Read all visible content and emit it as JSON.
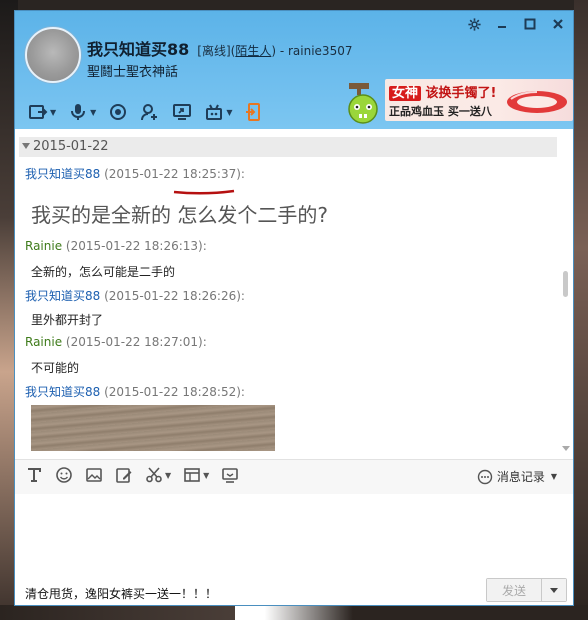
{
  "header": {
    "contact_name": "我只知道买88",
    "status_prefix": "[离线](",
    "stranger_label": "陌生人",
    "status_suffix": ") - rainie3507",
    "signature": "聖鬪士聖衣神話"
  },
  "window_controls": {
    "settings_icon": "gear-icon",
    "minimize_icon": "minimize-icon",
    "maximize_icon": "maximize-icon",
    "close_icon": "close-icon"
  },
  "toolbar_icons": [
    "share-screen-icon",
    "microphone-icon",
    "camera-icon",
    "add-person-icon",
    "remote-desktop-icon",
    "app-icon",
    "transfer-file-icon"
  ],
  "ad": {
    "highlight": "女神",
    "line1_rest": "该换手镯了!",
    "line2": "正品鸡血玉 买一送八",
    "accent": "#c21414"
  },
  "messages": {
    "date": "2015-01-22",
    "items": [
      {
        "sender": "我只知道买88",
        "time_a": "(2015-01-22 ",
        "time_b": "18:25:37",
        "time_c": "):",
        "text": "我买的是全新的 怎么发个二手的?"
      },
      {
        "sender": "Rainie",
        "time": "(2015-01-22 18:26:13):",
        "text": "全新的，怎么可能是二手的"
      },
      {
        "sender": "我只知道买88",
        "time": "(2015-01-22 18:26:26):",
        "text": "里外都开封了"
      },
      {
        "sender": "Rainie",
        "time": "(2015-01-22 18:27:01):",
        "text": "不可能的"
      },
      {
        "sender": "我只知道买88",
        "time": "(2015-01-22 18:28:52):"
      }
    ]
  },
  "input_toolbar": {
    "icons": [
      "font-icon",
      "emoji-icon",
      "image-icon",
      "edit-icon",
      "screenshot-scissors-icon",
      "grid-icon",
      "screen-icon"
    ],
    "history_label": "消息记录"
  },
  "footer": {
    "notice": "清仓甩货，逸阳女裤买一送一！！！",
    "send_label": "发送"
  },
  "colors": {
    "header_blue": "#6fbeee",
    "link_blue": "#1c5fb0",
    "other_green": "#3e7b1a"
  }
}
